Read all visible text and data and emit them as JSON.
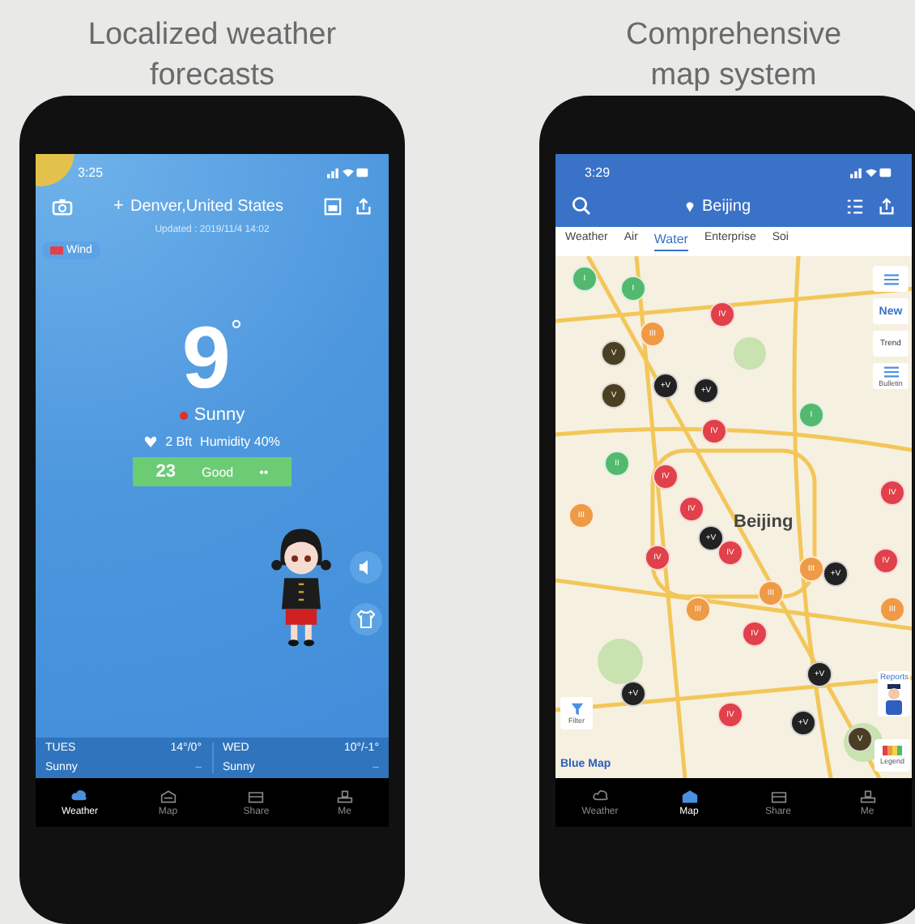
{
  "captions": [
    "Localized weather forecasts",
    "Comprehensive map system"
  ],
  "weather_screen": {
    "status_time": "3:25",
    "location_prefix": "+",
    "location": "Denver,United States",
    "updated": "Updated : 2019/11/4 14:02",
    "wind_chip": "Wind",
    "temperature": "9",
    "degree": "°",
    "condition": "Sunny",
    "wind": "2 Bft",
    "humidity": "Humidity 40%",
    "aqi": {
      "value": "23",
      "label": "Good",
      "extra": "••"
    },
    "forecast": [
      {
        "day": "TUES",
        "temp": "14°/0°",
        "condition": "Sunny",
        "extra": "–"
      },
      {
        "day": "WED",
        "temp": "10°/-1°",
        "condition": "Sunny",
        "extra": "–"
      }
    ],
    "nav": [
      {
        "label": "Weather",
        "selected": true
      },
      {
        "label": "Map",
        "selected": false
      },
      {
        "label": "Share",
        "selected": false
      },
      {
        "label": "Me",
        "selected": false
      }
    ]
  },
  "map_screen": {
    "status_time": "3:29",
    "location": "Beijing",
    "tabs": [
      {
        "label": "Weather",
        "selected": false
      },
      {
        "label": "Air",
        "selected": false
      },
      {
        "label": "Water",
        "selected": true
      },
      {
        "label": "Enterprise",
        "selected": false
      },
      {
        "label": "Soi",
        "selected": false
      }
    ],
    "side_buttons": [
      {
        "kind": "icon"
      },
      {
        "kind": "text",
        "label": "New"
      },
      {
        "kind": "text",
        "label": "Trend"
      },
      {
        "kind": "icon",
        "label": "Bulletin"
      }
    ],
    "city_label": "Beijing",
    "filter_label": "Filter",
    "reports_label": "Reports",
    "legend_label": "Legend",
    "logo": "Blue Map",
    "markers": [
      {
        "label": "I",
        "color": "#52b96f"
      },
      {
        "label": "I",
        "color": "#52b96f"
      },
      {
        "label": "III",
        "color": "#ef9a45"
      },
      {
        "label": "V",
        "color": "#4a3f22"
      },
      {
        "label": "IV",
        "color": "#e0414a"
      },
      {
        "label": "V",
        "color": "#4a3f22"
      },
      {
        "label": "+V",
        "color": "#222222"
      },
      {
        "label": "+V",
        "color": "#222222"
      },
      {
        "label": "IV",
        "color": "#e0414a"
      },
      {
        "label": "I",
        "color": "#52b96f"
      },
      {
        "label": "II",
        "color": "#52b96f"
      },
      {
        "label": "IV",
        "color": "#e0414a"
      },
      {
        "label": "III",
        "color": "#ef9a45"
      },
      {
        "label": "IV",
        "color": "#e0414a"
      },
      {
        "label": "+V",
        "color": "#222222"
      },
      {
        "label": "IV",
        "color": "#e0414a"
      },
      {
        "label": "IV",
        "color": "#e0414a"
      },
      {
        "label": "III",
        "color": "#ef9a45"
      },
      {
        "label": "+V",
        "color": "#222222"
      },
      {
        "label": "IV",
        "color": "#e0414a"
      },
      {
        "label": "III",
        "color": "#ef9a45"
      },
      {
        "label": "IV",
        "color": "#e0414a"
      },
      {
        "label": "III",
        "color": "#ef9a45"
      },
      {
        "label": "+V",
        "color": "#222222"
      },
      {
        "label": "IV",
        "color": "#e0414a"
      },
      {
        "label": "+V",
        "color": "#222222"
      },
      {
        "label": "V",
        "color": "#4a3f22"
      },
      {
        "label": "+V",
        "color": "#222222"
      },
      {
        "label": "IV",
        "color": "#e0414a"
      },
      {
        "label": "III",
        "color": "#ef9a45"
      }
    ],
    "nav": [
      {
        "label": "Weather",
        "selected": false
      },
      {
        "label": "Map",
        "selected": true
      },
      {
        "label": "Share",
        "selected": false
      },
      {
        "label": "Me",
        "selected": false
      }
    ]
  }
}
